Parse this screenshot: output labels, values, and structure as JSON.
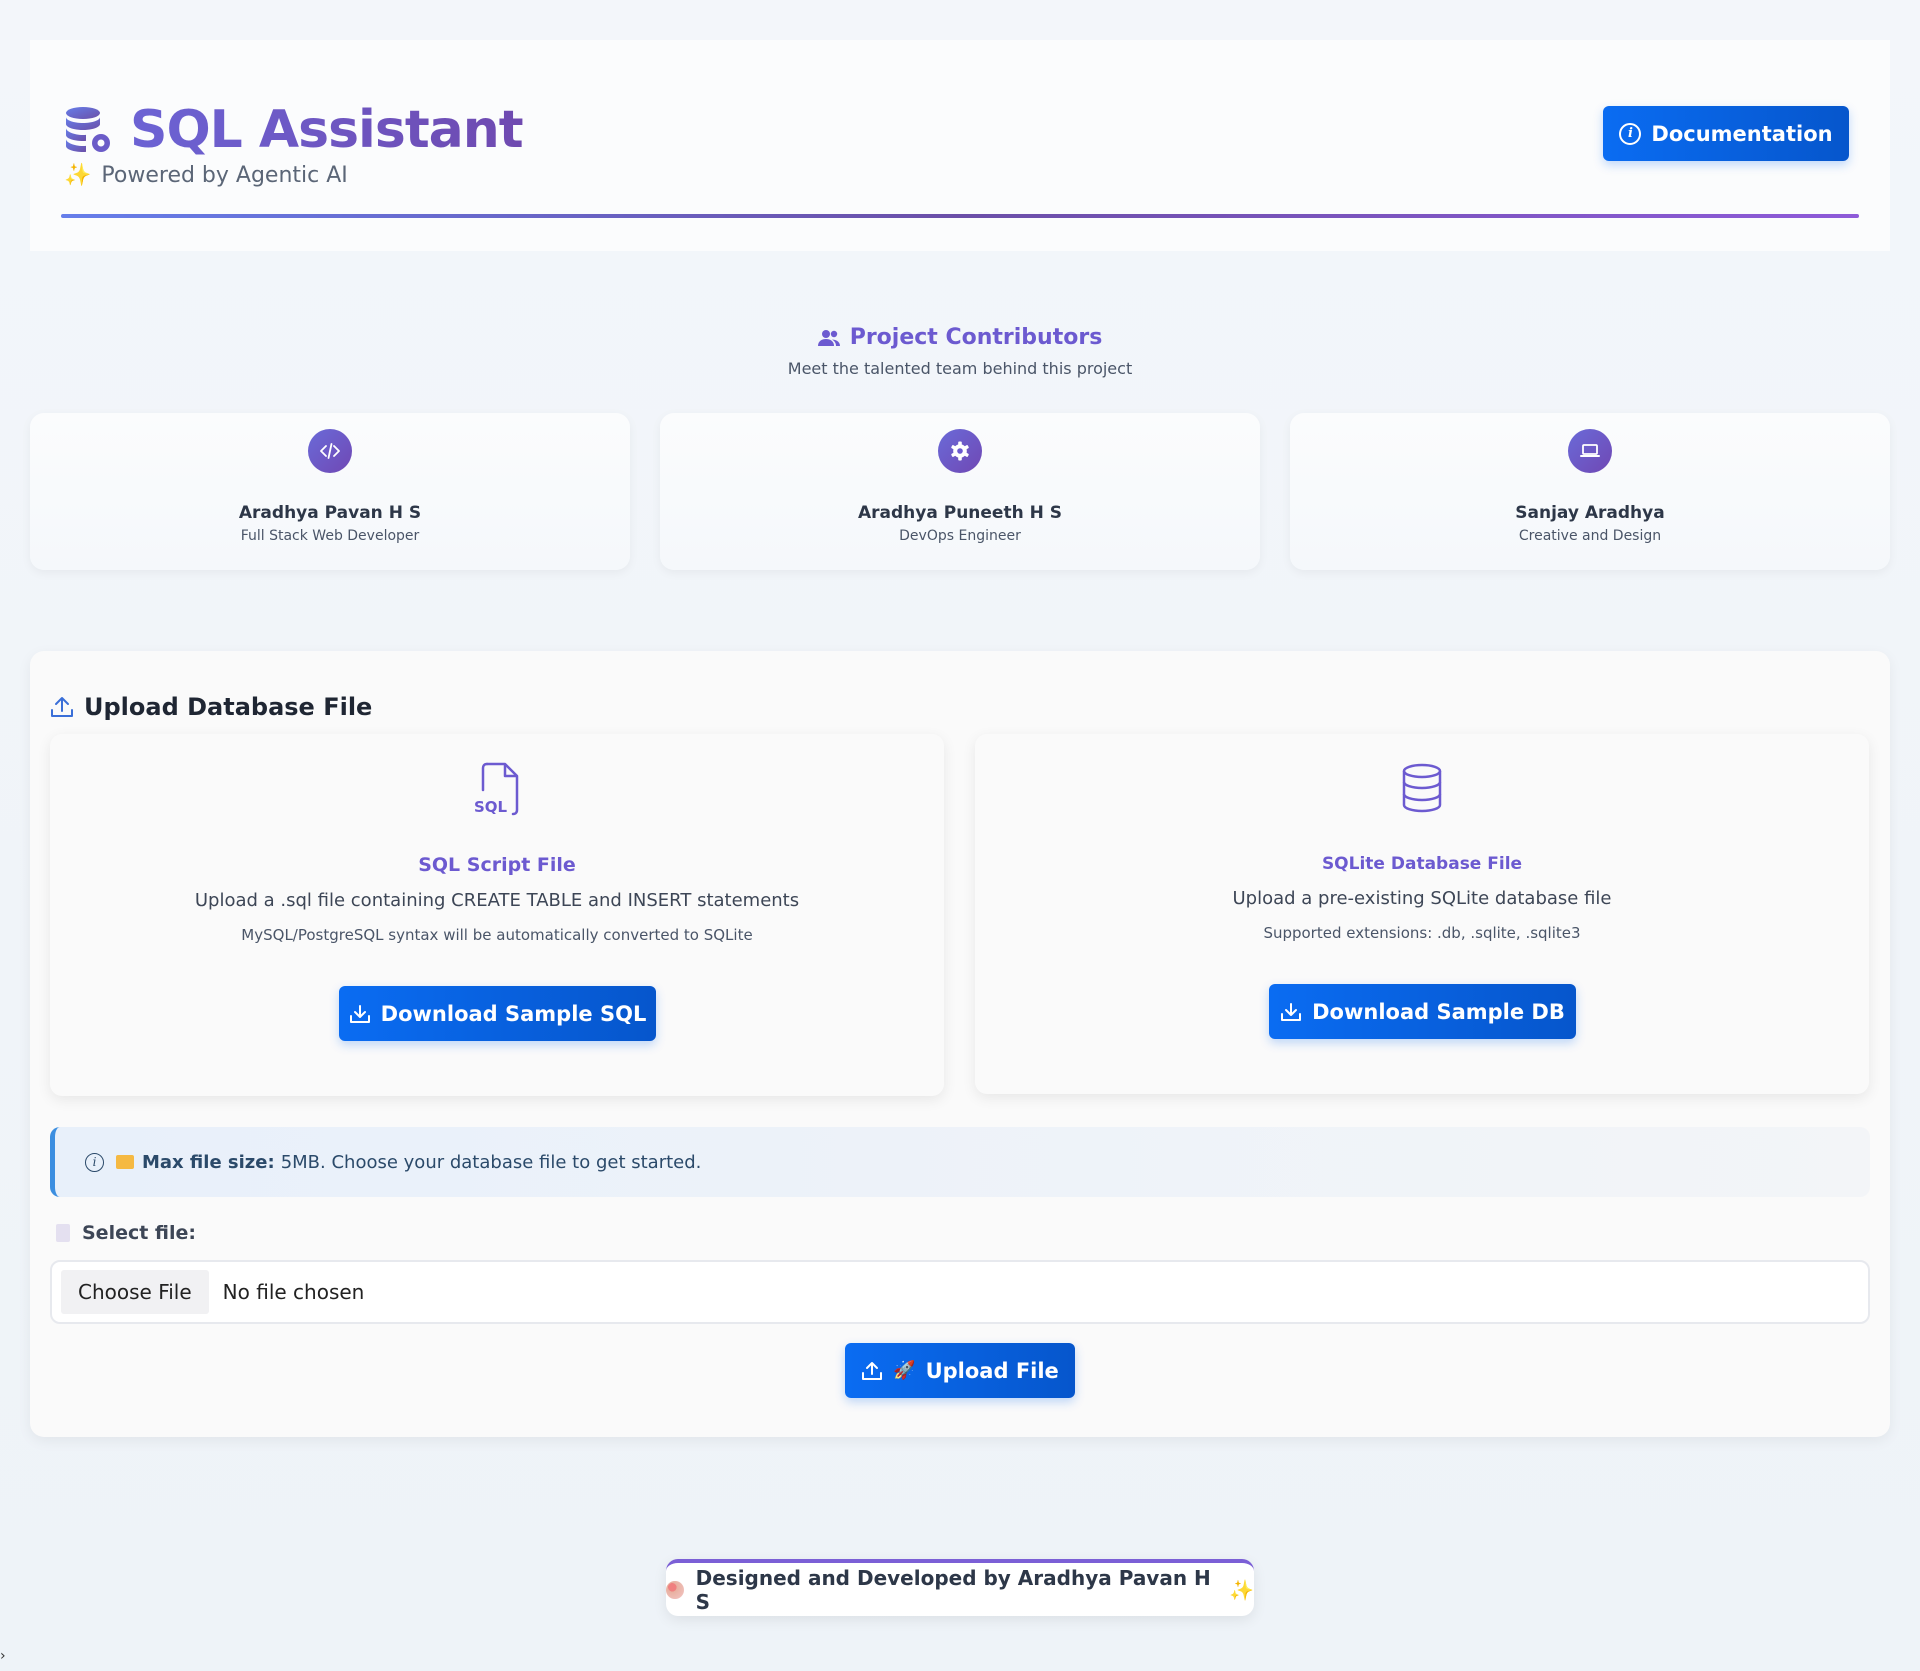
{
  "header": {
    "title": "SQL Assistant",
    "subtitle": "Powered by Agentic AI",
    "documentation_label": "Documentation"
  },
  "contributors": {
    "title": "Project Contributors",
    "subtitle": "Meet the talented team behind this project",
    "people": [
      {
        "name": "Aradhya Pavan H S",
        "role": "Full Stack Web Developer",
        "icon": "code-icon"
      },
      {
        "name": "Aradhya Puneeth H S",
        "role": "DevOps Engineer",
        "icon": "gear-icon"
      },
      {
        "name": "Sanjay Aradhya",
        "role": "Creative and Design",
        "icon": "laptop-icon"
      }
    ]
  },
  "upload": {
    "title": "Upload Database File",
    "sql_card": {
      "icon_label": "SQL",
      "title": "SQL Script File",
      "description": "Upload a .sql file containing CREATE TABLE and INSERT statements",
      "note": "MySQL/PostgreSQL syntax will be automatically converted to SQLite",
      "button_label": "Download Sample SQL"
    },
    "db_card": {
      "title": "SQLite Database File",
      "description": "Upload a pre-existing SQLite database file",
      "note": "Supported extensions: .db, .sqlite, .sqlite3",
      "button_label": "Download Sample DB"
    },
    "alert": {
      "bold": "Max file size:",
      "text": "5MB. Choose your database file to get started."
    },
    "select_label": "Select file:",
    "choose_button": "Choose File",
    "no_file": "No file chosen",
    "upload_button": "Upload File"
  },
  "footer": {
    "text": "Designed and Developed by Aradhya Pavan H S"
  },
  "colors": {
    "accent": "#6c5ad0",
    "primary_button": "#0a6cf2",
    "alert_border": "#3b8ee0"
  }
}
